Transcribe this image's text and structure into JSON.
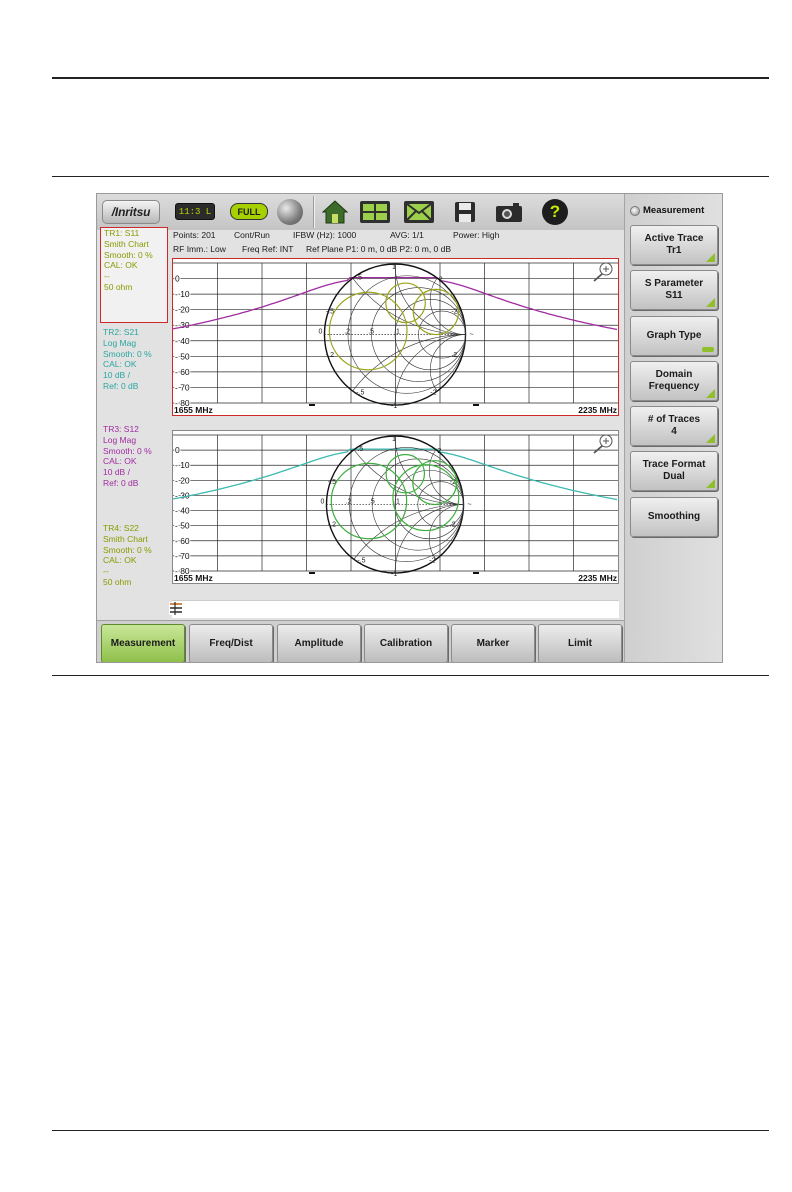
{
  "toolbar": {
    "logo_text": "/Inritsu",
    "battery_text": "11:3 L",
    "power_badge": "FULL",
    "icons": [
      "gps-icon",
      "home-icon",
      "layout-icon",
      "envelope-icon",
      "save-icon",
      "camera-icon",
      "help-icon"
    ],
    "help_glyph": "?"
  },
  "status": {
    "line1": [
      "Points: 201",
      "Cont/Run",
      "IFBW (Hz): 1000",
      "AVG: 1/1",
      "Power: High"
    ],
    "line2": [
      "RF Imm.: Low",
      "Freq Ref: INT",
      "Ref Plane P1: 0 m, 0 dB P2: 0 m, 0 dB"
    ]
  },
  "traces": [
    {
      "name": "TR1: S11",
      "format": "Smith Chart",
      "smooth": "Smooth: 0 %",
      "cal": "CAL: OK",
      "scale": "--",
      "ref": "50 ohm",
      "color": "#8a9a00",
      "active": true
    },
    {
      "name": "TR2: S21",
      "format": "Log Mag",
      "smooth": "Smooth: 0 %",
      "cal": "CAL: OK",
      "scale": "10 dB /",
      "ref": "Ref: 0 dB",
      "color": "#2aa6a0",
      "active": false
    },
    {
      "name": "TR3: S12",
      "format": "Log Mag",
      "smooth": "Smooth: 0 %",
      "cal": "CAL: OK",
      "scale": "10 dB /",
      "ref": "Ref: 0 dB",
      "color": "#a02ca0",
      "active": false
    },
    {
      "name": "TR4: S22",
      "format": "Smith Chart",
      "smooth": "Smooth: 0 %",
      "cal": "CAL: OK",
      "scale": "--",
      "ref": "50 ohm",
      "color": "#8a9a00",
      "active": false
    }
  ],
  "graphs": {
    "y_ticks": [
      "0",
      "- 10",
      "- 20",
      "- 30",
      "- 40",
      "- 50",
      "- 60",
      "- 70",
      "- 80"
    ],
    "freq_start": "1655 MHz",
    "freq_stop": "2235 MHz",
    "smith_labels": {
      "top": "1",
      "bottom": "-1",
      "ul": ".5",
      "ur": "2",
      "ml": "-.5",
      "mr": "-2",
      "center_left": "0",
      "c2": ".2",
      "c5": ".5",
      "c1": "1",
      "inf": "~",
      "lr": ".2",
      "ll": "-.2",
      "lb": "-.5",
      "rb": "-2",
      "fbottom": "-1"
    },
    "graph1_colors": {
      "logmag": "#a02ca0",
      "smith": "#9aa31c"
    },
    "graph2_colors": {
      "logmag": "#3bbab0",
      "smith": "#3fae3f"
    }
  },
  "right_panel": {
    "title": "Measurement",
    "buttons": [
      {
        "line1": "Active Trace",
        "line2": "Tr1"
      },
      {
        "line1": "S Parameter",
        "line2": "S11"
      },
      {
        "line1": "Graph Type",
        "line2": ""
      },
      {
        "line1": "Domain",
        "line2": "Frequency"
      },
      {
        "line1": "# of Traces",
        "line2": "4"
      },
      {
        "line1": "Trace Format",
        "line2": "Dual"
      },
      {
        "line1": "Smoothing",
        "line2": ""
      }
    ]
  },
  "tabs": [
    "Measurement",
    "Freq/Dist",
    "Amplitude",
    "Calibration",
    "Marker",
    "Limit"
  ],
  "selected_tab": "Measurement"
}
